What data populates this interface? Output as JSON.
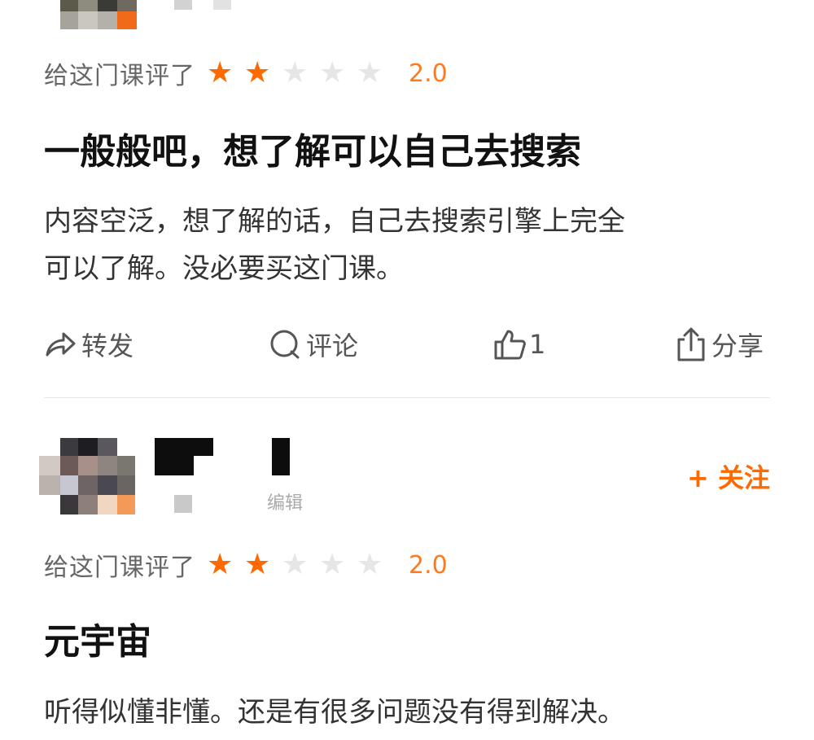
{
  "review1": {
    "rating_label": "给这门课评了",
    "stars": [
      true,
      true,
      false,
      false,
      false
    ],
    "score": "2.0",
    "title": "一般般吧，想了解可以自己去搜索",
    "body_line1": "内容空泛，想了解的话，自己去搜索引擎上完全",
    "body_line2": "可以了解。没必要买这门课。",
    "actions": {
      "forward_label": "转发",
      "comment_label": "评论",
      "like_count": "1",
      "share_label": "分享"
    }
  },
  "review2": {
    "follow_label": "+ 关注",
    "edited_label": "编辑",
    "rating_label": "给这门课评了",
    "stars": [
      true,
      true,
      false,
      false,
      false
    ],
    "score": "2.0",
    "title": "元宇宙",
    "body_line1": "听得似懂非懂。还是有很多问题没有得到解决。"
  },
  "colors": {
    "accent": "#ff6a00",
    "star_off": "#e6e6e6",
    "muted_text": "#666666"
  },
  "icons": [
    "forward-icon",
    "comment-icon",
    "thumbs-up-icon",
    "share-icon",
    "star-icon"
  ]
}
